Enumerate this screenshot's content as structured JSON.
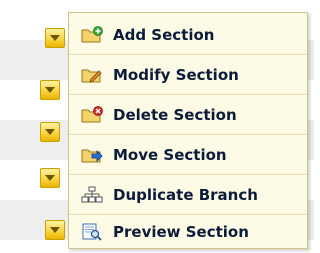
{
  "menu": {
    "items": [
      {
        "label": "Add Section",
        "icon": "folder-add-icon"
      },
      {
        "label": "Modify Section",
        "icon": "folder-edit-icon"
      },
      {
        "label": "Delete Section",
        "icon": "folder-delete-icon"
      },
      {
        "label": "Move Section",
        "icon": "folder-move-icon"
      },
      {
        "label": "Duplicate Branch",
        "icon": "duplicate-branch-icon"
      },
      {
        "label": "Preview Section",
        "icon": "preview-icon"
      }
    ]
  },
  "colors": {
    "menu_bg": "#fdfbe6",
    "dropdown_button": "#f8d23c",
    "label_text": "#0b1c3a",
    "row_shade": "#eeeeee"
  }
}
